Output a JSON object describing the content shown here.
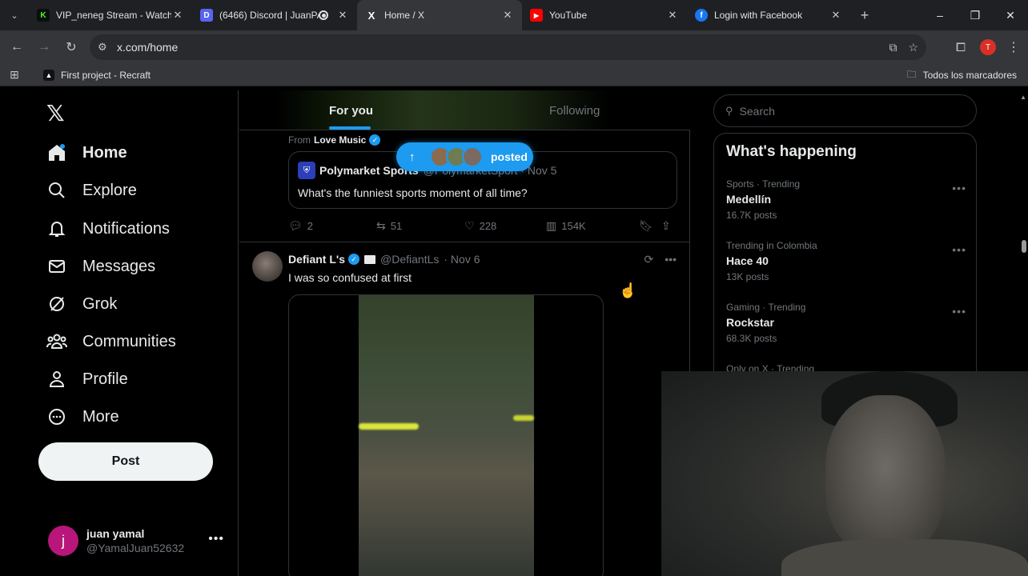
{
  "browser": {
    "tabs": [
      {
        "title": "VIP_neneg Stream - Watch L",
        "favicon": "K",
        "favicon_color": "#53fc18",
        "active": false
      },
      {
        "title": "(6466) Discord | JuanPA",
        "favicon": "D",
        "favicon_color": "#5865f2",
        "active": false
      },
      {
        "title": "Home / X",
        "favicon": "X",
        "favicon_color": "#000000",
        "active": true
      },
      {
        "title": "YouTube",
        "favicon": "▶",
        "favicon_color": "#ff0000",
        "active": false
      },
      {
        "title": "Login with Facebook",
        "favicon": "f",
        "favicon_color": "#1877f2",
        "active": false
      }
    ],
    "url": "x.com/home",
    "profile_initial": "T",
    "bookmarks": [
      {
        "label": "First project - Recraft"
      }
    ],
    "all_bookmarks_label": "Todos los marcadores"
  },
  "sidebar": {
    "items": [
      {
        "label": "Home",
        "icon": "home-icon"
      },
      {
        "label": "Explore",
        "icon": "search-icon"
      },
      {
        "label": "Notifications",
        "icon": "bell-icon"
      },
      {
        "label": "Messages",
        "icon": "mail-icon"
      },
      {
        "label": "Grok",
        "icon": "grok-icon"
      },
      {
        "label": "Communities",
        "icon": "communities-icon"
      },
      {
        "label": "Profile",
        "icon": "person-icon"
      },
      {
        "label": "More",
        "icon": "more-circle-icon"
      }
    ],
    "post_label": "Post",
    "account": {
      "name": "juan yamal",
      "handle": "@YamalJuan52632",
      "initial": "j"
    }
  },
  "feed": {
    "tabs": [
      "For you",
      "Following"
    ],
    "from_prefix": "From",
    "from_source": "Love Music",
    "new_posts_label": "posted",
    "quote": {
      "name": "Polymarket Sports",
      "meta": "@PolymarketSport · Nov 5",
      "text": "What's the funniest sports moment of all time?"
    },
    "stats": {
      "replies": "2",
      "reposts": "51",
      "likes": "228",
      "views": "154K"
    },
    "tweet2": {
      "name": "Defiant L's",
      "handle": "@DefiantLs",
      "date": "· Nov 6",
      "text": "I was so confused at first"
    }
  },
  "right": {
    "search_placeholder": "Search",
    "trends_title": "What's happening",
    "trends": [
      {
        "context": "Sports · Trending",
        "name": "Medellín",
        "count": "16.7K posts"
      },
      {
        "context": "Trending in Colombia",
        "name": "Hace 40",
        "count": "13K posts"
      },
      {
        "context": "Gaming · Trending",
        "name": "Rockstar",
        "count": "68.3K posts"
      },
      {
        "context": "Only on X · Trending",
        "name": "",
        "count": ""
      }
    ]
  },
  "colors": {
    "accent": "#1d9bf0",
    "background": "#000000",
    "border": "#2f3336"
  }
}
